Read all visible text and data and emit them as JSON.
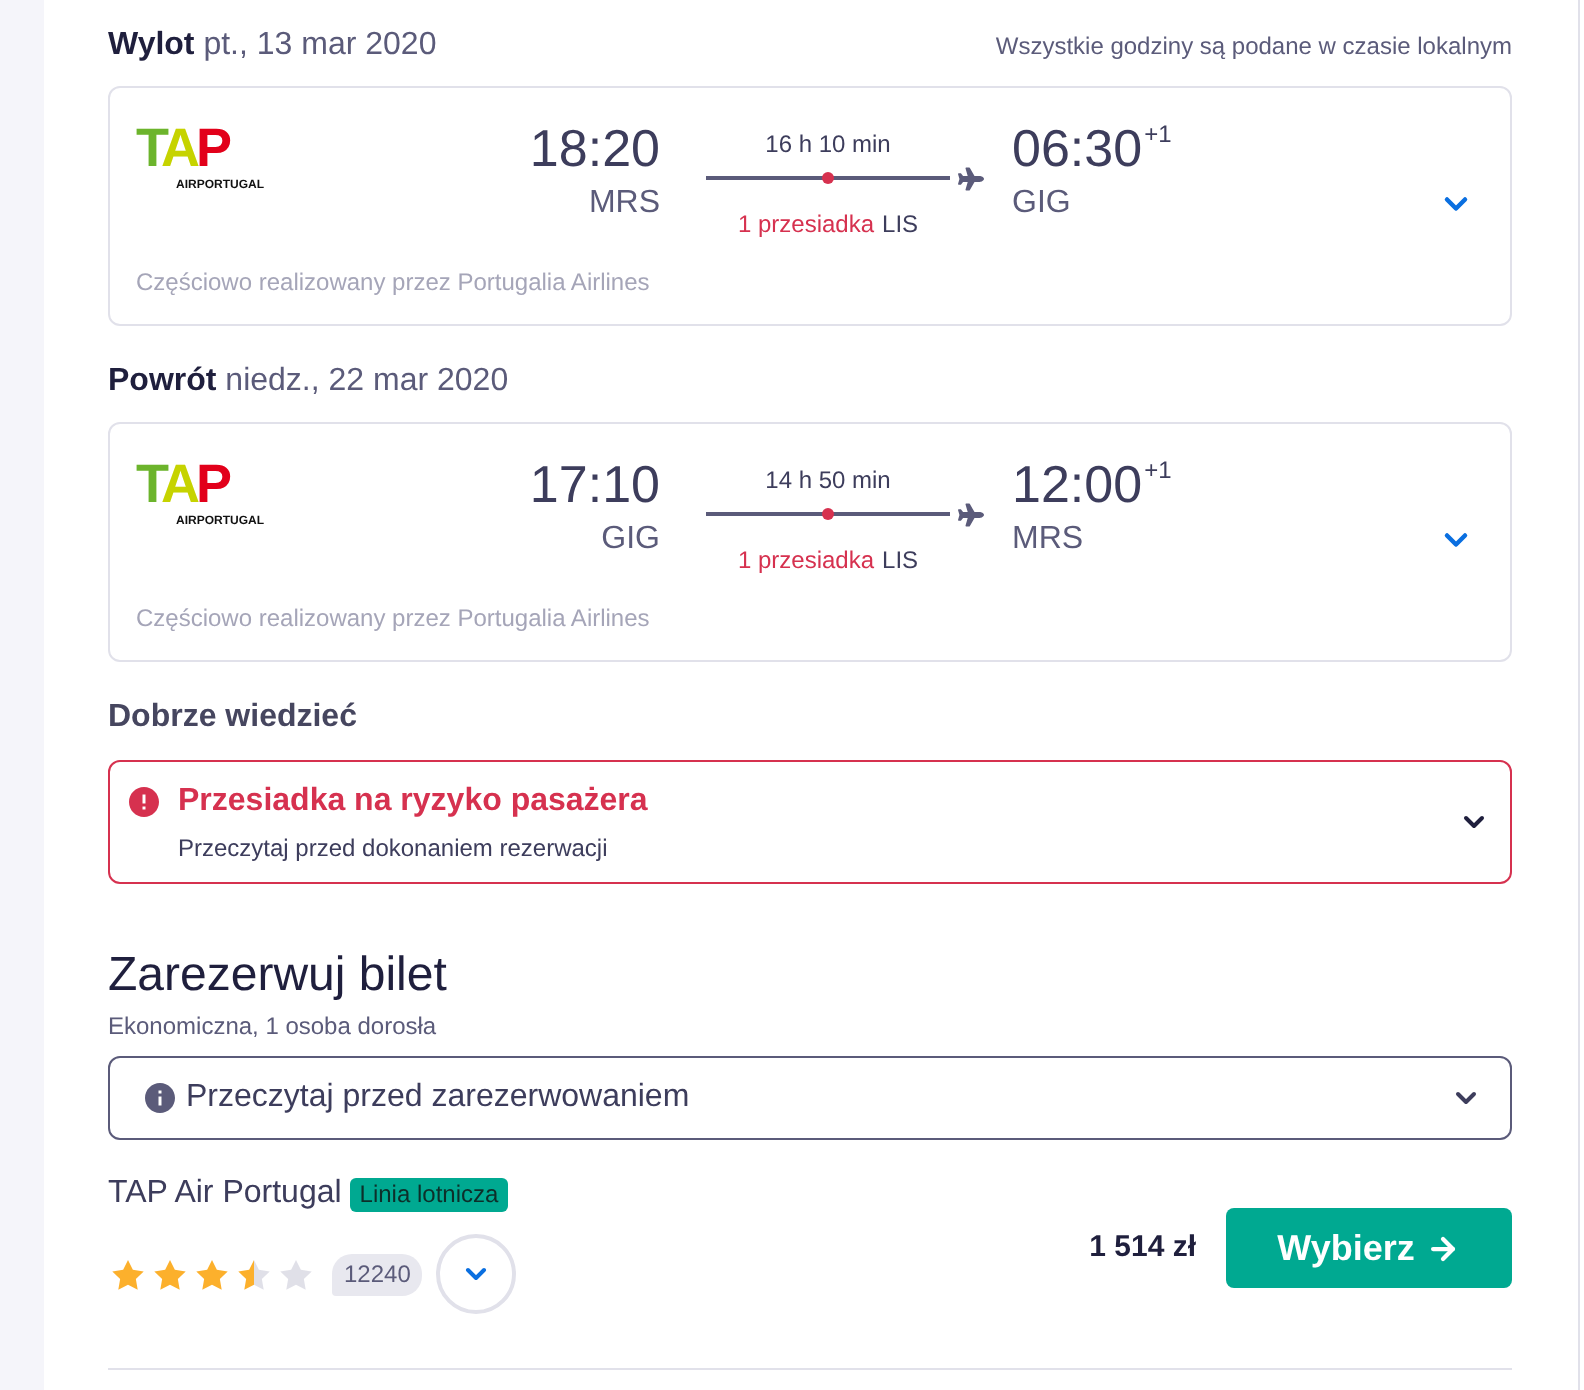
{
  "legs": [
    {
      "heading": "**Wylot** pt., 13 mar 2020",
      "note": "Wszystkie godziny są podane w czasie lokalnym",
      "logo": {
        "mark": "TAP",
        "caption": "AIRPORTUGAL"
      },
      "departure": {
        "time": "18:20",
        "airport": "MRS"
      },
      "duration": "16 h 10 min",
      "stops": "1 przesiadka",
      "via": "LIS",
      "arrival": {
        "time": "06:30",
        "day_offset": "+1",
        "airport": "GIG"
      },
      "operated_by": "Częściowo realizowany przez Portugalia Airlines",
      "expanded": false
    },
    {
      "heading": "**Powrót** niedz., 22 mar 2020",
      "logo": {
        "mark": "TAP",
        "caption": "AIRPORTUGAL"
      },
      "departure": {
        "time": "17:10",
        "airport": "GIG"
      },
      "duration": "14 h 50 min",
      "stops": "1 przesiadka",
      "via": "LIS",
      "arrival": {
        "time": "12:00",
        "day_offset": "+1",
        "airport": "MRS"
      },
      "operated_by": "Częściowo realizowany przez Portugalia Airlines",
      "expanded": false
    }
  ],
  "good_to_know": {
    "title": "Dobrze wiedzieć",
    "alert": {
      "title": "Przesiadka na ryzyko pasażera",
      "text": "Przeczytaj przed dokonaniem rezerwacji",
      "expanded": false
    }
  },
  "booking": {
    "title": "Zarezerwuj bilet",
    "subtitle": "Ekonomiczna, 1 osoba dorosła",
    "notice": {
      "label": "Przeczytaj przed zarezerwowaniem",
      "expanded": false
    },
    "offer": {
      "provider": "TAP Air Portugal",
      "tag": "Linia lotnicza",
      "stars": 3.5,
      "reviews": "12240",
      "expanded": false,
      "price": "1 514 zł",
      "button": "Wybierz"
    }
  }
}
